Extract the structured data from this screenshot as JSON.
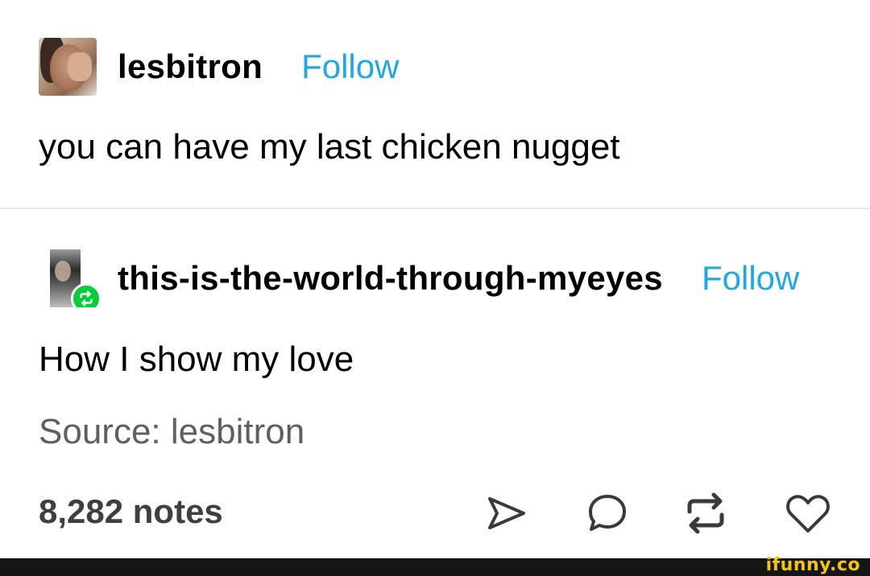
{
  "post": {
    "username": "lesbitron",
    "follow_label": "Follow",
    "text": "you can have my last chicken nugget"
  },
  "reblog": {
    "username": "this-is-the-world-through-myeyes",
    "follow_label": "Follow",
    "text": "How I show my love",
    "source": "Source: lesbitron"
  },
  "footer": {
    "notes": "8,282 notes",
    "actions": [
      "share-icon",
      "reply-icon",
      "reblog-icon",
      "like-icon"
    ]
  },
  "watermark": "ifunny.co",
  "colors": {
    "follow": "#1ea8e5",
    "reblog_badge": "#00cf35",
    "notes_text": "#3f3f3f",
    "watermark": "#f2c700"
  }
}
